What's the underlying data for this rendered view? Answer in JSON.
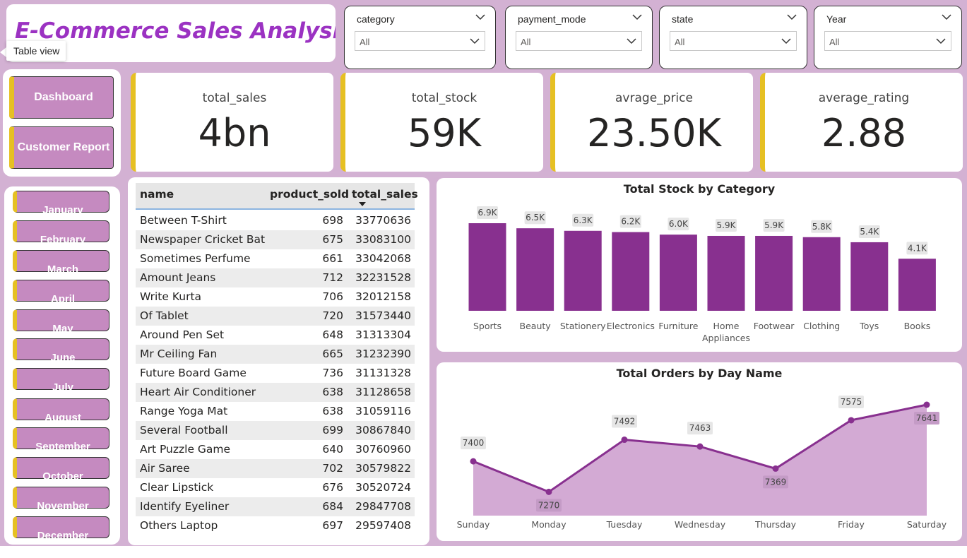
{
  "title": "E-Commerce Sales Analysis",
  "tooltip": "Table view",
  "slicers": [
    {
      "title": "category",
      "value": "All"
    },
    {
      "title": "payment_mode",
      "value": "All"
    },
    {
      "title": "state",
      "value": "All"
    },
    {
      "title": "Year",
      "value": "All"
    }
  ],
  "nav": {
    "dashboard": "Dashboard",
    "customer_report": "Customer Report"
  },
  "months": [
    "January",
    "February",
    "March",
    "April",
    "May",
    "June",
    "July",
    "August",
    "September",
    "October",
    "November",
    "December"
  ],
  "kpis": [
    {
      "label": "total_sales",
      "value": "4bn"
    },
    {
      "label": "total_stock",
      "value": "59K"
    },
    {
      "label": "avrage_price",
      "value": "23.50K"
    },
    {
      "label": "average_rating",
      "value": "2.88"
    }
  ],
  "table": {
    "headers": {
      "name": "name",
      "product_sold": "product_sold",
      "total_sales": "total_sales"
    },
    "rows": [
      {
        "name": "Between T-Shirt",
        "sold": "698",
        "sales": "33770636"
      },
      {
        "name": "Newspaper Cricket Bat",
        "sold": "675",
        "sales": "33083100"
      },
      {
        "name": "Sometimes Perfume",
        "sold": "661",
        "sales": "33042068"
      },
      {
        "name": "Amount Jeans",
        "sold": "712",
        "sales": "32231528"
      },
      {
        "name": "Write Kurta",
        "sold": "706",
        "sales": "32012158"
      },
      {
        "name": "Of Tablet",
        "sold": "720",
        "sales": "31573440"
      },
      {
        "name": "Around Pen Set",
        "sold": "648",
        "sales": "31313304"
      },
      {
        "name": "Mr Ceiling Fan",
        "sold": "665",
        "sales": "31232390"
      },
      {
        "name": "Future Board Game",
        "sold": "736",
        "sales": "31131328"
      },
      {
        "name": "Heart Air Conditioner",
        "sold": "638",
        "sales": "31128658"
      },
      {
        "name": "Range Yoga Mat",
        "sold": "638",
        "sales": "31059116"
      },
      {
        "name": "Several Football",
        "sold": "699",
        "sales": "30867840"
      },
      {
        "name": "Art Puzzle Game",
        "sold": "640",
        "sales": "30760960"
      },
      {
        "name": "Air Saree",
        "sold": "702",
        "sales": "30579822"
      },
      {
        "name": "Clear Lipstick",
        "sold": "676",
        "sales": "30520724"
      },
      {
        "name": "Identify Eyeliner",
        "sold": "684",
        "sales": "29847708"
      },
      {
        "name": "Others Laptop",
        "sold": "697",
        "sales": "29597408"
      }
    ]
  },
  "colors": {
    "accent": "#88308f",
    "area_fill": "#d3aad4",
    "button": "#c58ac0",
    "button_stripe": "#e6c023",
    "title": "#9b32c2",
    "background": "#d3b1d3"
  },
  "chart_data": [
    {
      "type": "bar",
      "title": "Total Stock by Category",
      "categories": [
        "Sports",
        "Beauty",
        "Stationery",
        "Electronics",
        "Furniture",
        "Home Appliances",
        "Footwear",
        "Clothing",
        "Toys",
        "Books"
      ],
      "category_lines": [
        [
          "Sports"
        ],
        [
          "Beauty"
        ],
        [
          "Stationery"
        ],
        [
          "Electronics"
        ],
        [
          "Furniture"
        ],
        [
          "Home",
          "Appliances"
        ],
        [
          "Footwear"
        ],
        [
          "Clothing"
        ],
        [
          "Toys"
        ],
        [
          "Books"
        ]
      ],
      "values": [
        6900,
        6500,
        6300,
        6200,
        6000,
        5900,
        5900,
        5800,
        5400,
        4100
      ],
      "data_labels": [
        "6.9K",
        "6.5K",
        "6.3K",
        "6.2K",
        "6.0K",
        "5.9K",
        "5.9K",
        "5.8K",
        "5.4K",
        "4.1K"
      ],
      "ylim": [
        0,
        6900
      ],
      "grid": false,
      "xlabel": "",
      "ylabel": ""
    },
    {
      "type": "area",
      "title": "Total Orders by Day Name",
      "categories": [
        "Sunday",
        "Monday",
        "Tuesday",
        "Wednesday",
        "Thursday",
        "Friday",
        "Saturday"
      ],
      "values": [
        7400,
        7270,
        7492,
        7463,
        7369,
        7575,
        7641
      ],
      "data_labels": [
        "7400",
        "7270",
        "7492",
        "7463",
        "7369",
        "7575",
        "7641"
      ],
      "ylim": [
        7250,
        7641
      ],
      "grid": false,
      "xlabel": "",
      "ylabel": ""
    }
  ]
}
